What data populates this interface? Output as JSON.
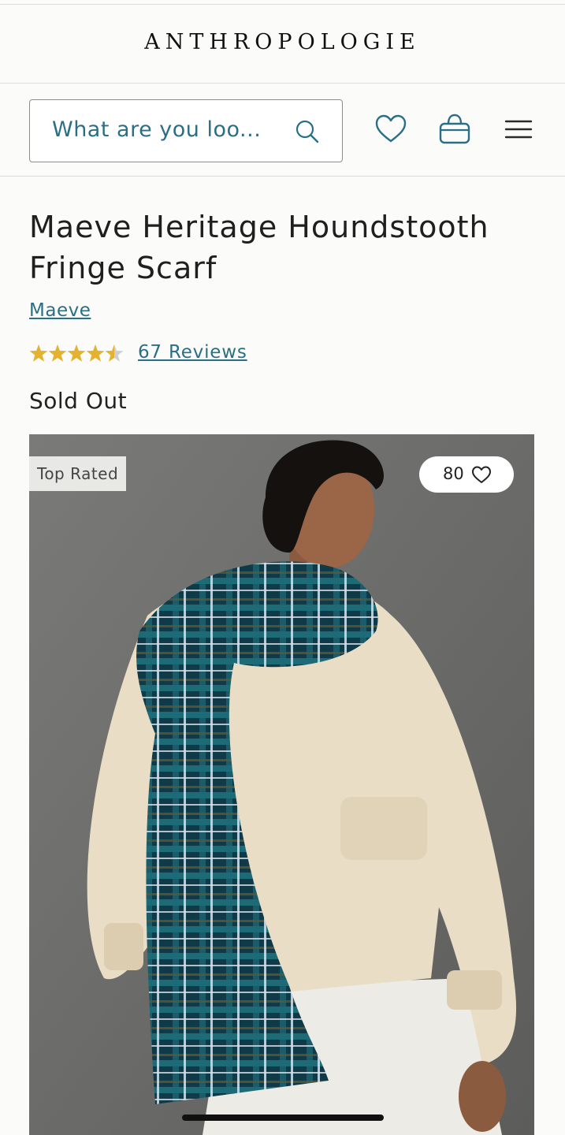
{
  "header": {
    "logo": "ANTHROPOLOGIE",
    "search_placeholder": "What are you loo...",
    "icons": [
      "search-icon",
      "heart-icon",
      "bag-icon",
      "menu-icon"
    ]
  },
  "product": {
    "title": "Maeve Heritage Houndstooth Fringe Scarf",
    "brand": "Maeve",
    "rating": 4.5,
    "rating_max": 5,
    "reviews_label": "67 Reviews",
    "status": "Sold Out",
    "badge": "Top Rated",
    "favorites_count": "80"
  },
  "colors": {
    "accent": "#2b6f85",
    "star": "#e3b22f",
    "text": "#222222",
    "background": "#fbfbf9"
  }
}
